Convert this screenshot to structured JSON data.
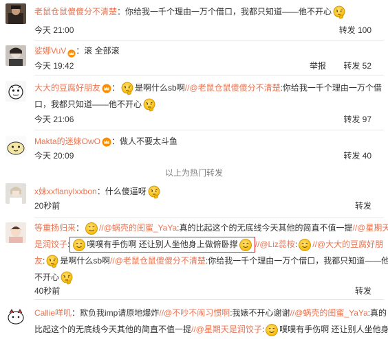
{
  "hot_comments": [
    {
      "user": "老鼠仓鼠傻傻分不清楚",
      "text": "：你给我一千个理由一万个借口，我都只知道——他不开心",
      "time": "今天 21:00",
      "repost": "转发 100"
    },
    {
      "user": "娑娜VuV",
      "text": "：滚 全部滚",
      "time": "今天 19:42",
      "report": "举报",
      "repost": "转发 52"
    },
    {
      "user": "大大的豆腐好朋友",
      "text1": "是啊什么sb啊",
      "mention1": "//@老鼠仓鼠傻傻分不清楚",
      "text2": ":你给我一千个理由一万个借",
      "text3": "口，我都只知道——他不开心",
      "time": "今天 21:06",
      "repost": "转发 97"
    },
    {
      "user": "Makta的迷妹OwO",
      "text": "：做人不要太斗鱼",
      "time": "今天 20:09",
      "repost": "转发 40"
    }
  ],
  "divider_label": "以上为热门转发",
  "comments": [
    {
      "user": "x妹xxflanyIxxbon",
      "text": "：什么傻逼呀",
      "time": "20秒前",
      "repost": "转发"
    },
    {
      "user": "等重扬归来",
      "seg1": "：",
      "mention1": "//@蜗壳的闺蜜_YaYa",
      "seg2": ":真的比起这个的无底线今天其他的简直不值一提",
      "mention2": "//@星期天",
      "seg3": "是润饺子",
      "seg4": ":",
      "boxed_text": "噗噗有手伤啊 还让别人坐他身上做俯卧撑",
      "mention3": "//@Liz蕊桉",
      "mention4": "//@大大的豆腐好朋",
      "seg5": "友",
      "seg6": ":",
      "seg7": "是啊什么sb啊",
      "mention5": "//@老鼠仓鼠傻傻分不清楚",
      "seg8": ":你给我一千个理由一万个借口，我都只知道——他",
      "seg9": "不开心",
      "time": "40秒前",
      "repost": "转发"
    },
    {
      "user": "Callie咩叽",
      "seg1": "：欺负我imp请原地爆炸",
      "mention1": "//@不吵不闹习惯啊",
      "seg2": ":我婊不开心谢谢",
      "mention2": "//@蜗壳的闺蜜_YaYa",
      "seg3": ":真的",
      "seg4": "比起这个的无底线今天其他的简直不值一提",
      "mention3": "//@星期天是润饺子",
      "seg5": ":",
      "seg6": "噗噗有手伤啊 还让别人坐他身"
    }
  ],
  "colors": {
    "link": "#eb7350",
    "text": "#333333",
    "muted": "#808080",
    "separator": "#e6e6e6",
    "highlight_border": "#e02020"
  },
  "icons": [
    "emoji-smile-icon",
    "emoji-thinking-icon",
    "vip-badge-icon",
    "crown-badge-icon"
  ]
}
